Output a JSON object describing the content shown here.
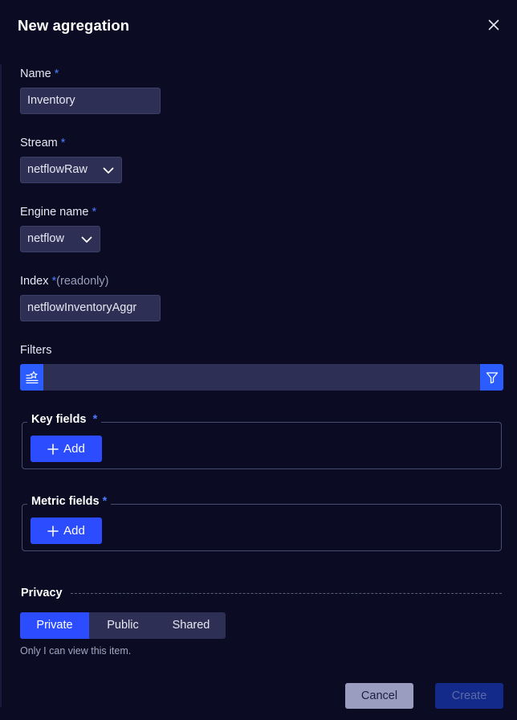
{
  "dialog": {
    "title": "New agregation"
  },
  "form": {
    "name": {
      "label": "Name",
      "required": "*",
      "value": "Inventory"
    },
    "stream": {
      "label": "Stream",
      "required": "*",
      "value": "netflowRaw"
    },
    "engine": {
      "label": "Engine name",
      "required": "*",
      "value": "netflow"
    },
    "index": {
      "label": "Index",
      "required": "*",
      "note": "(readonly)",
      "value": "netflowInventoryAggr"
    },
    "filters": {
      "label": "Filters",
      "value": ""
    }
  },
  "key_fields": {
    "legend": "Key fields",
    "required": "*",
    "add_label": "Add"
  },
  "metric_fields": {
    "legend": "Metric fields",
    "required": "*",
    "add_label": "Add"
  },
  "privacy": {
    "label": "Privacy",
    "options": [
      "Private",
      "Public",
      "Shared"
    ],
    "selected": "Private",
    "hint": "Only I can view this item."
  },
  "footer": {
    "cancel_label": "Cancel",
    "create_label": "Create"
  },
  "colors": {
    "background": "#0b0b24",
    "accent": "#2b4cff",
    "input_bg": "#2d2f54",
    "required_marker": "#4c7bff"
  }
}
